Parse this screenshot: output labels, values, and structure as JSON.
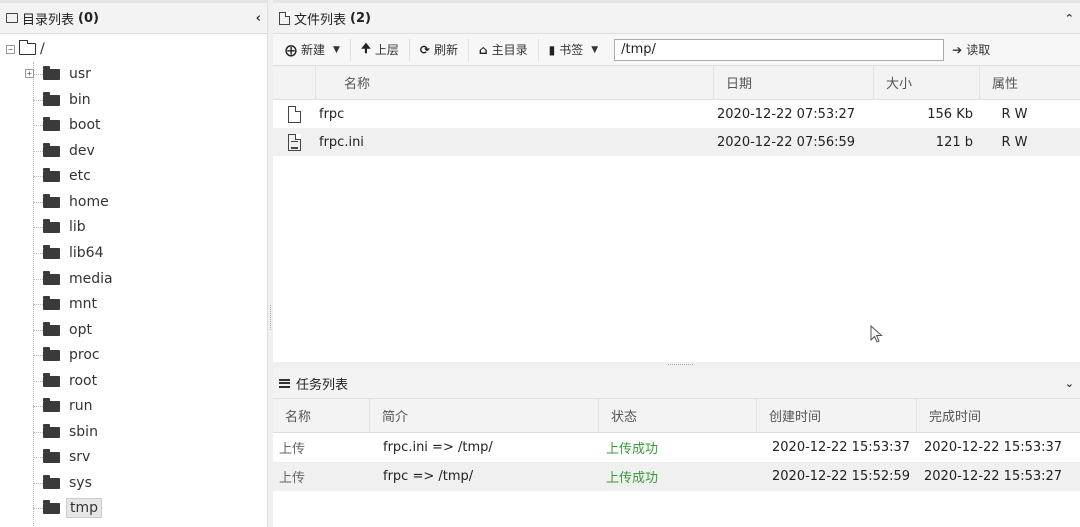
{
  "dir_panel": {
    "title": "目录列表",
    "count": "(0)",
    "collapse_icon": "chevron-left-icon",
    "root": "/",
    "items": [
      {
        "name": "usr",
        "expandable": true
      },
      {
        "name": "bin"
      },
      {
        "name": "boot"
      },
      {
        "name": "dev"
      },
      {
        "name": "etc"
      },
      {
        "name": "home"
      },
      {
        "name": "lib"
      },
      {
        "name": "lib64"
      },
      {
        "name": "media"
      },
      {
        "name": "mnt"
      },
      {
        "name": "opt"
      },
      {
        "name": "proc"
      },
      {
        "name": "root"
      },
      {
        "name": "run"
      },
      {
        "name": "sbin"
      },
      {
        "name": "srv"
      },
      {
        "name": "sys"
      },
      {
        "name": "tmp",
        "selected": true
      }
    ]
  },
  "file_panel": {
    "title": "文件列表",
    "count": "(2)",
    "toolbar": {
      "new_label": "新建",
      "up_label": "上层",
      "refresh_label": "刷新",
      "home_label": "主目录",
      "bookmark_label": "书签",
      "path_value": "/tmp/",
      "read_label": "读取"
    },
    "columns": {
      "name": "名称",
      "date": "日期",
      "size": "大小",
      "attr": "属性"
    },
    "rows": [
      {
        "name": "frpc",
        "date": "2020-12-22 07:53:27",
        "size": "156 Kb",
        "attr": "R W",
        "icon": "file-icon"
      },
      {
        "name": "frpc.ini",
        "date": "2020-12-22 07:56:59",
        "size": "121 b",
        "attr": "R W",
        "icon": "text-file-icon"
      }
    ]
  },
  "task_panel": {
    "title": "任务列表",
    "columns": {
      "name": "名称",
      "desc": "简介",
      "status": "状态",
      "created": "创建时间",
      "done": "完成时间"
    },
    "rows": [
      {
        "name": "上传",
        "desc": "frpc.ini => /tmp/",
        "status": "上传成功",
        "created": "2020-12-22 15:53:37",
        "done": "2020-12-22 15:53:37"
      },
      {
        "name": "上传",
        "desc": "frpc => /tmp/",
        "status": "上传成功",
        "created": "2020-12-22 15:52:59",
        "done": "2020-12-22 15:53:27"
      }
    ],
    "status_color": "#3a9a3a"
  }
}
